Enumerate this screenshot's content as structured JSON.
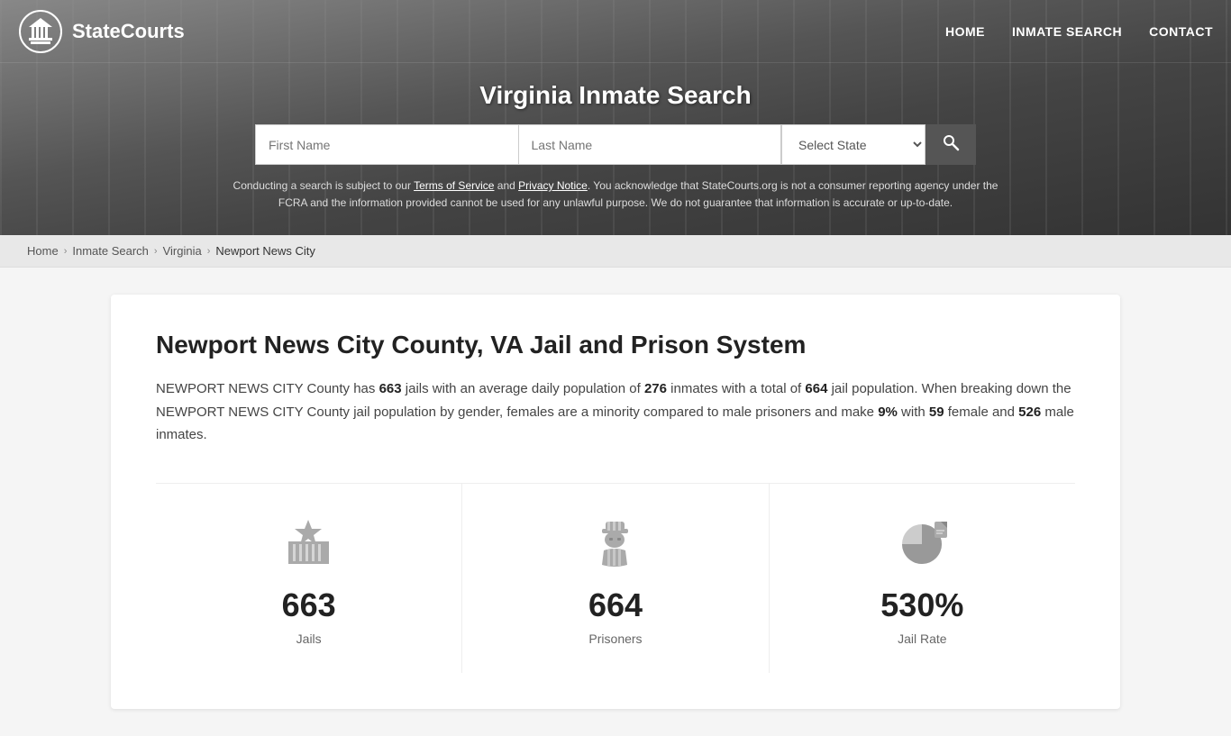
{
  "nav": {
    "logo_text": "StateCourts",
    "links": [
      {
        "label": "HOME",
        "href": "#"
      },
      {
        "label": "INMATE SEARCH",
        "href": "#"
      },
      {
        "label": "CONTACT",
        "href": "#"
      }
    ]
  },
  "header": {
    "title": "Virginia Inmate Search",
    "search": {
      "first_name_placeholder": "First Name",
      "last_name_placeholder": "Last Name",
      "state_placeholder": "Select State",
      "button_label": "🔍"
    },
    "disclaimer": "Conducting a search is subject to our Terms of Service and Privacy Notice. You acknowledge that StateCourts.org is not a consumer reporting agency under the FCRA and the information provided cannot be used for any unlawful purpose. We do not guarantee that information is accurate or up-to-date."
  },
  "breadcrumb": {
    "items": [
      {
        "label": "Home",
        "href": "#"
      },
      {
        "label": "Inmate Search",
        "href": "#"
      },
      {
        "label": "Virginia",
        "href": "#"
      },
      {
        "label": "Newport News City",
        "current": true
      }
    ]
  },
  "content": {
    "title": "Newport News City County, VA Jail and Prison System",
    "description_parts": [
      "NEWPORT NEWS CITY County has ",
      "663",
      " jails with an average daily population of ",
      "276",
      " inmates with a total of ",
      "664",
      " jail population. When breaking down the NEWPORT NEWS CITY County jail population by gender, females are a minority compared to male prisoners and make ",
      "9%",
      " with ",
      "59",
      " female and ",
      "526",
      " male inmates."
    ]
  },
  "stats": [
    {
      "icon": "jail",
      "number": "663",
      "label": "Jails"
    },
    {
      "icon": "prisoner",
      "number": "664",
      "label": "Prisoners"
    },
    {
      "icon": "chart",
      "number": "530%",
      "label": "Jail Rate"
    }
  ]
}
